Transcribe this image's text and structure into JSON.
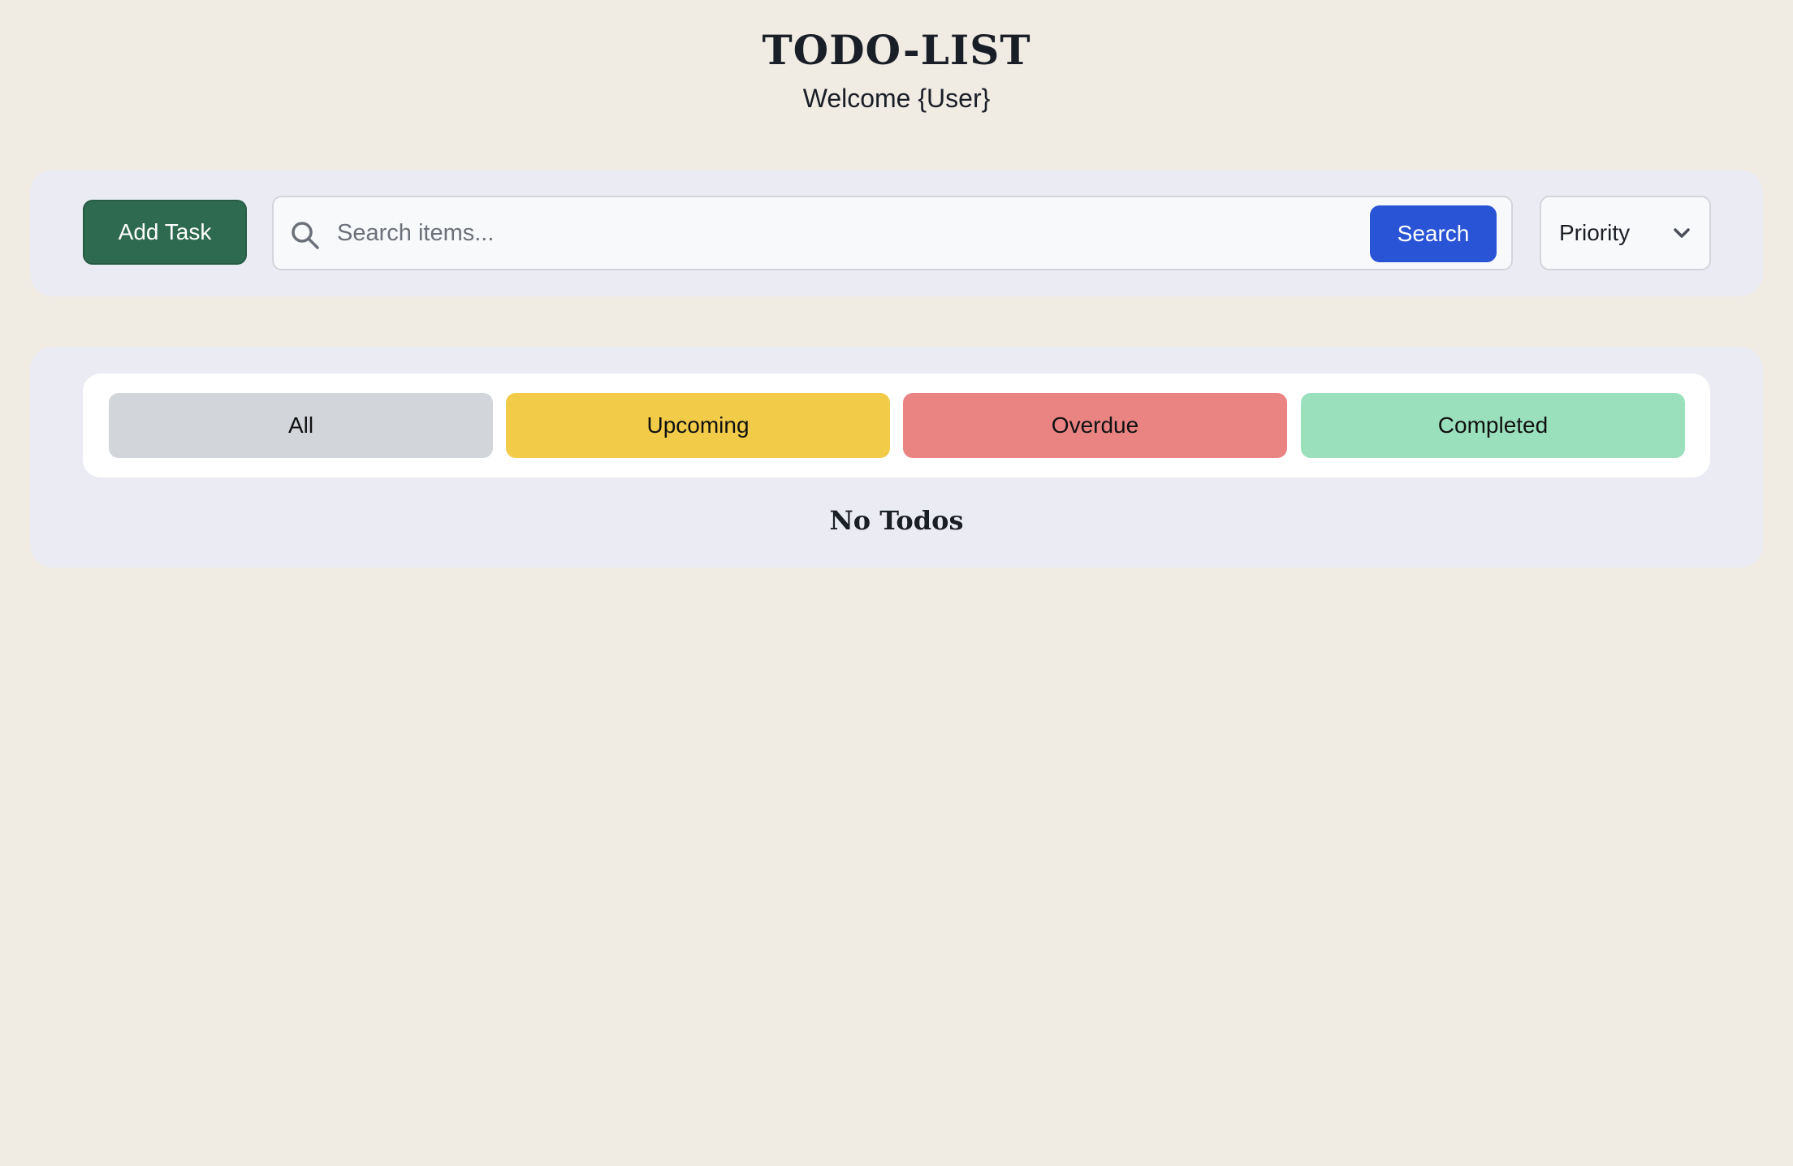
{
  "header": {
    "title": "TODO-LIST",
    "welcome": "Welcome {User}"
  },
  "toolbar": {
    "add_task_label": "Add Task",
    "search": {
      "placeholder": "Search items...",
      "value": "",
      "button_label": "Search",
      "icon": "search-icon"
    },
    "priority": {
      "selected": "Priority",
      "icon": "chevron-down-icon"
    }
  },
  "filters": {
    "tabs": [
      {
        "label": "All",
        "color": "#d2d5da"
      },
      {
        "label": "Upcoming",
        "color": "#f2cc48"
      },
      {
        "label": "Overdue",
        "color": "#ea8483"
      },
      {
        "label": "Completed",
        "color": "#9be0bd"
      }
    ]
  },
  "list": {
    "empty_message": "No Todos"
  },
  "colors": {
    "page_background": "#f0ece4",
    "card_background": "#ebebf3",
    "add_task_button": "#2d6a4f",
    "search_button": "#2a54d6"
  }
}
